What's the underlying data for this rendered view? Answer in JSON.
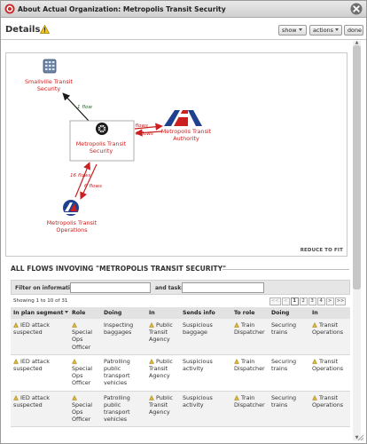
{
  "window": {
    "title": "About Actual Organization: Metropolis Transit Security"
  },
  "details": {
    "title": "Details",
    "buttons": {
      "show": "show",
      "actions": "actions",
      "done": "done"
    }
  },
  "graph": {
    "nodes": {
      "smallville": [
        "Smallville Transit",
        "Security"
      ],
      "metro_security": [
        "Metropolis Transit",
        "Security"
      ],
      "authority": [
        "Metropolis Transit",
        "Authority"
      ],
      "operations": [
        "Metropolis Transit",
        "Operations"
      ]
    },
    "edges": {
      "to_smallville": "1 flow",
      "to_authority": "5 flows",
      "from_authority": "3 flows",
      "from_operations": "16 flows",
      "to_operations": "6 flows"
    },
    "reduce_to_fit": "REDUCE TO FIT"
  },
  "flows": {
    "heading": "ALL FLOWS INVOVING \"METROPOLIS TRANSIT SECURITY\"",
    "filter_info_label": "Filter on information:",
    "filter_task_label": "and task:",
    "filter_info_value": "",
    "filter_task_value": "",
    "showing": "Showing 1 to 10 of 31",
    "pager": [
      "<<",
      "<",
      "1",
      "2",
      "3",
      "4",
      ">",
      ">>"
    ],
    "columns": [
      "In plan segment",
      "Role",
      "Doing",
      "In",
      "Sends info",
      "To role",
      "Doing",
      "In"
    ],
    "rows": [
      [
        "IED attack suspected",
        "Special Ops Officer",
        "Inspecting baggages",
        "Public Transit Agency",
        "Suspicious baggage",
        "Train Dispatcher",
        "Securing trains",
        "Transit Operations"
      ],
      [
        "IED attack suspected",
        "Special Ops Officer",
        "Patrolling public transport vehicles",
        "Public Transit Agency",
        "Suspicious activity",
        "Train Dispatcher",
        "Securing trains",
        "Transit Operations"
      ],
      [
        "IED attack suspected",
        "Special Ops Officer",
        "Patrolling public transport vehicles",
        "Public Transit Agency",
        "Suspicious activity",
        "Train Dispatcher",
        "Securing trains",
        "Transit Operations"
      ]
    ]
  },
  "colors": {
    "node_label": "#cc1f1f",
    "edge_red": "#cc1f1f",
    "edge_dark": "#1b1b1b",
    "edge_label_green": "#2a6a2a"
  },
  "icons": {
    "title": "bullseye-icon",
    "close": "close-x-icon",
    "warning": "warning-icon",
    "smallville": "building-icon",
    "metro_security": "wheel-icon",
    "authority": "transit-authority-logo",
    "operations": "transit-operations-logo"
  }
}
